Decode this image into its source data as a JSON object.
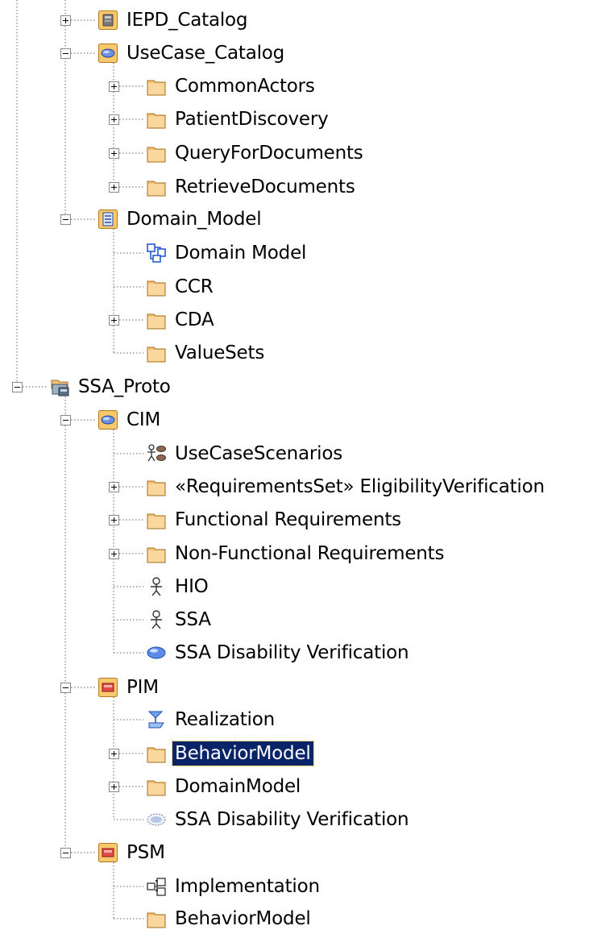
{
  "tree": {
    "items": [
      {
        "label": "IEPD_Catalog",
        "icon": "gear-package-icon",
        "state": "collapsed"
      },
      {
        "label": "UseCase_Catalog",
        "icon": "usecase-package-icon",
        "state": "expanded"
      },
      {
        "label": "CommonActors",
        "icon": "folder-icon",
        "state": "collapsed"
      },
      {
        "label": "PatientDiscovery",
        "icon": "folder-icon",
        "state": "collapsed"
      },
      {
        "label": "QueryForDocuments",
        "icon": "folder-icon",
        "state": "collapsed"
      },
      {
        "label": "RetrieveDocuments",
        "icon": "folder-icon",
        "state": "collapsed"
      },
      {
        "label": "Domain_Model",
        "icon": "domain-package-icon",
        "state": "expanded"
      },
      {
        "label": "Domain Model",
        "icon": "class-diagram-icon",
        "state": "leaf"
      },
      {
        "label": "CCR",
        "icon": "folder-icon",
        "state": "leaf"
      },
      {
        "label": "CDA",
        "icon": "folder-icon",
        "state": "collapsed"
      },
      {
        "label": "ValueSets",
        "icon": "folder-icon",
        "state": "leaf"
      },
      {
        "label": "SSA_Proto",
        "icon": "project-icon",
        "state": "expanded"
      },
      {
        "label": "CIM",
        "icon": "usecase-package-icon",
        "state": "expanded"
      },
      {
        "label": "UseCaseScenarios",
        "icon": "usecase-diagram-icon",
        "state": "leaf"
      },
      {
        "label": "«RequirementsSet» EligibilityVerification",
        "icon": "folder-icon",
        "state": "collapsed"
      },
      {
        "label": "Functional Requirements",
        "icon": "folder-icon",
        "state": "collapsed"
      },
      {
        "label": "Non-Functional Requirements",
        "icon": "folder-icon",
        "state": "collapsed"
      },
      {
        "label": "HIO",
        "icon": "actor-icon",
        "state": "leaf"
      },
      {
        "label": "SSA",
        "icon": "actor-icon",
        "state": "leaf"
      },
      {
        "label": "SSA Disability Verification",
        "icon": "usecase-icon",
        "state": "leaf"
      },
      {
        "label": "PIM",
        "icon": "model-package-icon",
        "state": "expanded"
      },
      {
        "label": "Realization",
        "icon": "realization-diagram-icon",
        "state": "leaf"
      },
      {
        "label": "BehaviorModel",
        "icon": "folder-icon",
        "state": "collapsed",
        "selected": true
      },
      {
        "label": "DomainModel",
        "icon": "folder-icon",
        "state": "collapsed"
      },
      {
        "label": "SSA Disability Verification",
        "icon": "collaboration-icon",
        "state": "leaf"
      },
      {
        "label": "PSM",
        "icon": "model-package-icon",
        "state": "expanded"
      },
      {
        "label": "Implementation",
        "icon": "component-diagram-icon",
        "state": "leaf"
      },
      {
        "label": "BehaviorModel",
        "icon": "folder-icon",
        "state": "leaf"
      }
    ]
  }
}
